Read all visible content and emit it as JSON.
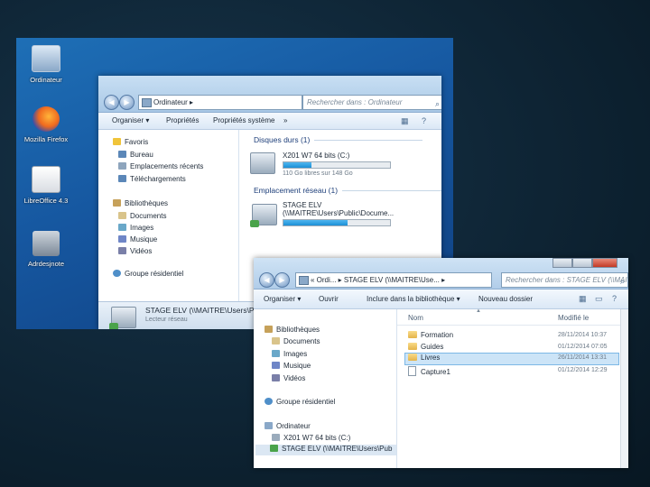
{
  "desktop": {
    "icons": [
      {
        "label": "Ordinateur",
        "icon": "computer-icon"
      },
      {
        "label": "Mozilla Firefox",
        "icon": "firefox-icon"
      },
      {
        "label": "LibreOffice 4.3",
        "icon": "libreoffice-icon"
      },
      {
        "label": "Adrdesjnote",
        "icon": "shortcut-icon"
      }
    ]
  },
  "win1": {
    "address": "Ordinateur ▸",
    "search_placeholder": "Rechercher dans : Ordinateur",
    "toolbar": {
      "organise": "Organiser ▾",
      "properties": "Propriétés",
      "system": "Propriétés système",
      "more": "»"
    },
    "nav": [
      {
        "label": "Favoris",
        "type": "star"
      },
      {
        "label": "Bureau",
        "type": "folder"
      },
      {
        "label": "Emplacements récents",
        "type": "folder"
      },
      {
        "label": "Téléchargements",
        "type": "folder"
      },
      {
        "label": "Bibliothèques",
        "type": "lib"
      },
      {
        "label": "Documents",
        "type": "folder"
      },
      {
        "label": "Images",
        "type": "folder"
      },
      {
        "label": "Musique",
        "type": "folder"
      },
      {
        "label": "Vidéos",
        "type": "folder"
      },
      {
        "label": "Groupe résidentiel",
        "type": "home"
      }
    ],
    "section_disks": "Disques durs (1)",
    "drive_name": "X201 W7 64 bits (C:)",
    "drive_free": "110 Go libres sur 148 Go",
    "drive_used_fraction": 0.26,
    "section_network": "Emplacement réseau (1)",
    "net_name_1": "STAGE ELV",
    "net_name_2": "(\\\\MAITRE\\Users\\Public\\Docume...",
    "net_used_fraction": 0.6,
    "details_name": "STAGE ELV (\\\\MAITRE\\Users\\Pub",
    "details_type": "Lecteur réseau"
  },
  "win2": {
    "address": "« Ordi... ▸ STAGE ELV (\\\\MAITRE\\Use... ▸",
    "search_placeholder": "Rechercher dans : STAGE ELV (\\\\MAITRE...",
    "toolbar": {
      "organise": "Organiser ▾",
      "open": "Ouvrir",
      "include": "Inclure dans la bibliothèque ▾",
      "newfolder": "Nouveau dossier"
    },
    "nav": [
      {
        "label": "Bibliothèques",
        "indent": 0
      },
      {
        "label": "Documents",
        "indent": 1
      },
      {
        "label": "Images",
        "indent": 1
      },
      {
        "label": "Musique",
        "indent": 1
      },
      {
        "label": "Vidéos",
        "indent": 1
      },
      {
        "label": "Groupe résidentiel",
        "indent": 0
      },
      {
        "label": "Ordinateur",
        "indent": 0
      },
      {
        "label": "X201 W7 64 bits (C:)",
        "indent": 1
      },
      {
        "label": "STAGE ELV (\\\\MAITRE\\Users\\Pub",
        "indent": 1
      }
    ],
    "columns": {
      "name": "Nom",
      "modified": "Modifié le"
    },
    "files": [
      {
        "name": "Formation",
        "date": "28/11/2014 10:37",
        "kind": "folder",
        "selected": false
      },
      {
        "name": "Guides",
        "date": "01/12/2014 07:05",
        "kind": "folder",
        "selected": false
      },
      {
        "name": "Livres",
        "date": "26/11/2014 13:31",
        "kind": "folder",
        "selected": true
      },
      {
        "name": "Capture1",
        "date": "01/12/2014 12:29",
        "kind": "file",
        "selected": false
      }
    ]
  }
}
